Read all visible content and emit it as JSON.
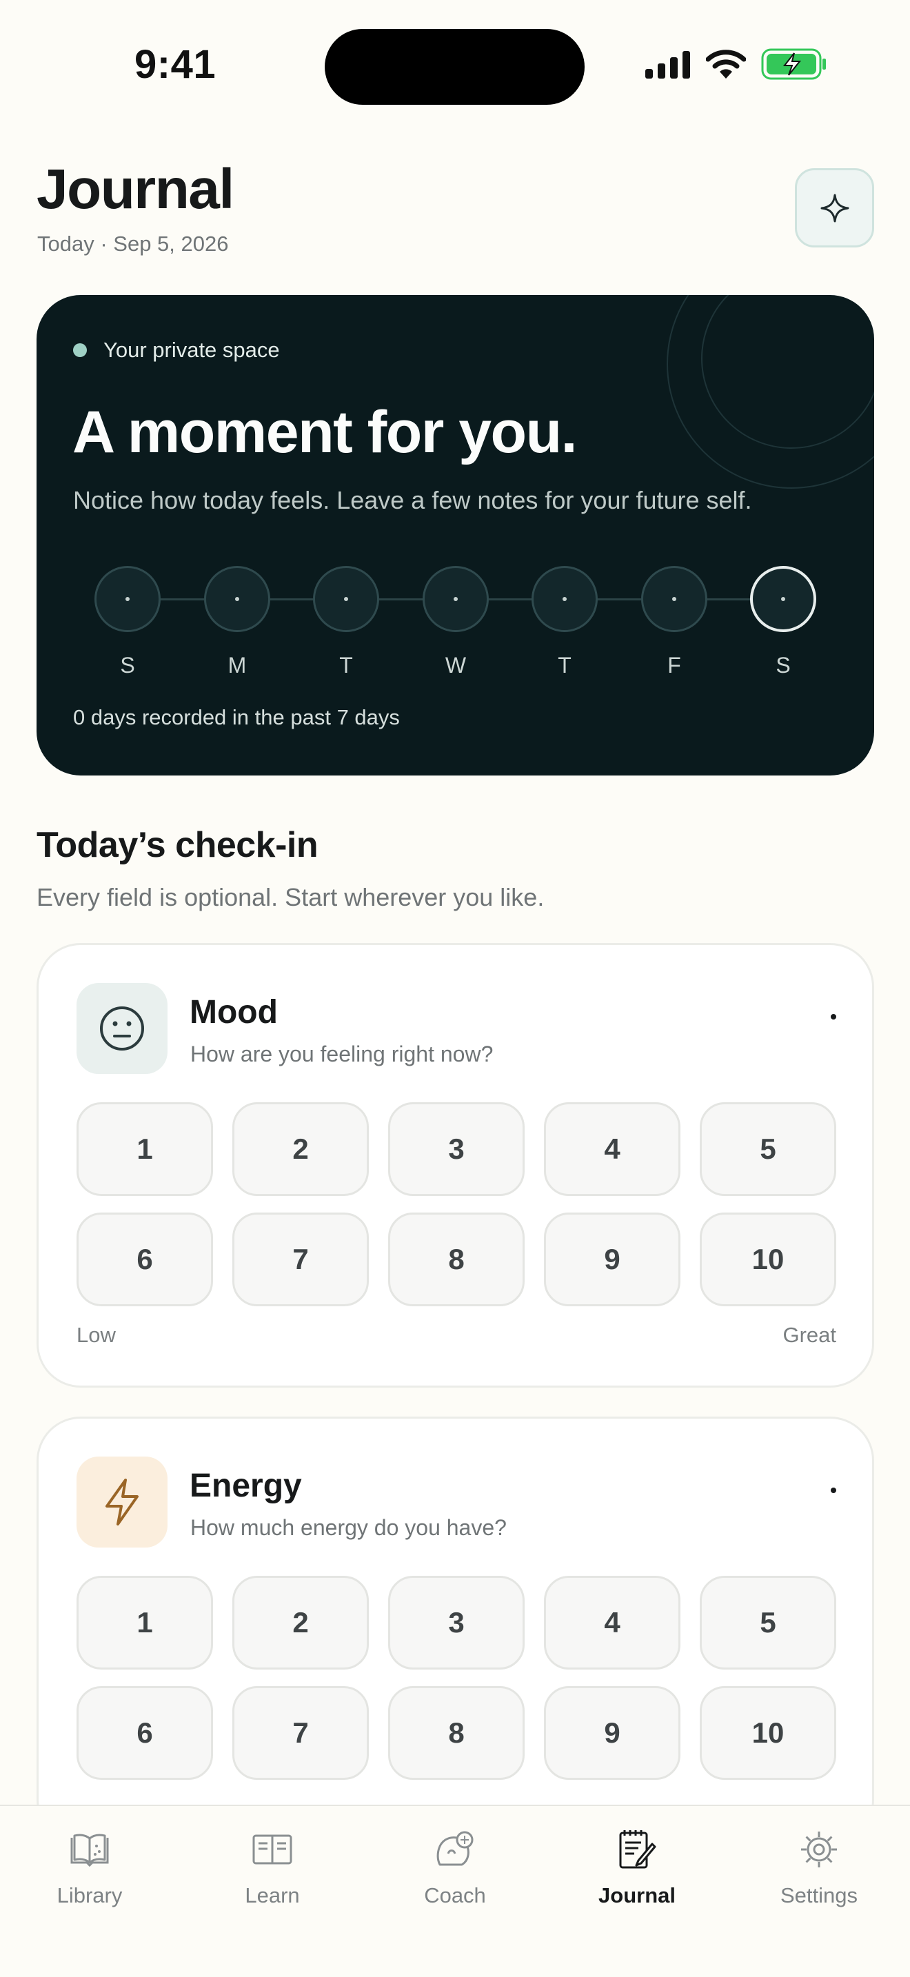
{
  "status_bar": {
    "time": "9:41"
  },
  "header": {
    "title": "Journal",
    "date": "Today · Sep 5, 2026"
  },
  "hero": {
    "badge": "Your private space",
    "title": "A moment for you.",
    "subtitle": "Notice how today feels. Leave a few notes for your future self.",
    "days": [
      "S",
      "M",
      "T",
      "W",
      "T",
      "F",
      "S"
    ],
    "footer": "0 days recorded in the past 7 days"
  },
  "checkin": {
    "title": "Today’s check-in",
    "subtitle": "Every field is optional. Start wherever you like."
  },
  "mood": {
    "title": "Mood",
    "subtitle": "How are you feeling right now?",
    "value": "·",
    "options": [
      "1",
      "2",
      "3",
      "4",
      "5",
      "6",
      "7",
      "8",
      "9",
      "10"
    ],
    "low_label": "Low",
    "high_label": "Great",
    "icon": "neutral-face-icon",
    "icon_bg": "#e9f0ee"
  },
  "energy": {
    "title": "Energy",
    "subtitle": "How much energy do you have?",
    "value": "·",
    "options": [
      "1",
      "2",
      "3",
      "4",
      "5",
      "6",
      "7",
      "8",
      "9",
      "10"
    ],
    "icon": "lightning-icon",
    "icon_bg": "#fbeedd"
  },
  "tabs": [
    {
      "label": "Library",
      "icon": "book-icon"
    },
    {
      "label": "Learn",
      "icon": "open-book-icon"
    },
    {
      "label": "Coach",
      "icon": "coach-icon"
    },
    {
      "label": "Journal",
      "icon": "journal-icon",
      "active": true
    },
    {
      "label": "Settings",
      "icon": "gear-icon"
    }
  ],
  "colors": {
    "background": "#fdfcf7",
    "hero": "#0a1a1d",
    "accent": "#9fd1c5",
    "battery": "#34c759"
  }
}
